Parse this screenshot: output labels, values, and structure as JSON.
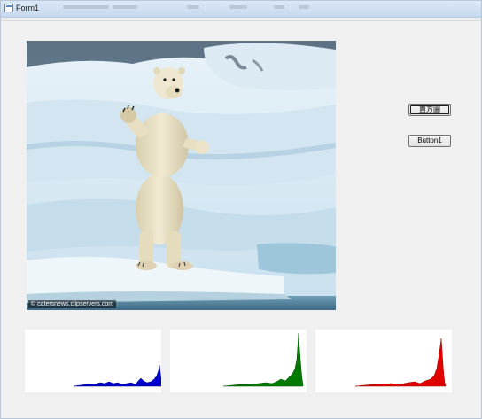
{
  "window": {
    "title": "Form1",
    "icon": "form-icon"
  },
  "image": {
    "subject": "polar-bear-on-ice",
    "watermark": "© catersnews.clipservers.com"
  },
  "buttons": {
    "histogram_label": "直方圖",
    "button1_label": "Button1"
  },
  "histograms": [
    {
      "channel": "blue",
      "color": "#0000cc"
    },
    {
      "channel": "green",
      "color": "#007a00"
    },
    {
      "channel": "red",
      "color": "#e00000"
    }
  ],
  "colors": {
    "window_bg": "#f0f0f0",
    "titlebar": "#c6d9ef",
    "histogram_bg": "#ffffff"
  }
}
